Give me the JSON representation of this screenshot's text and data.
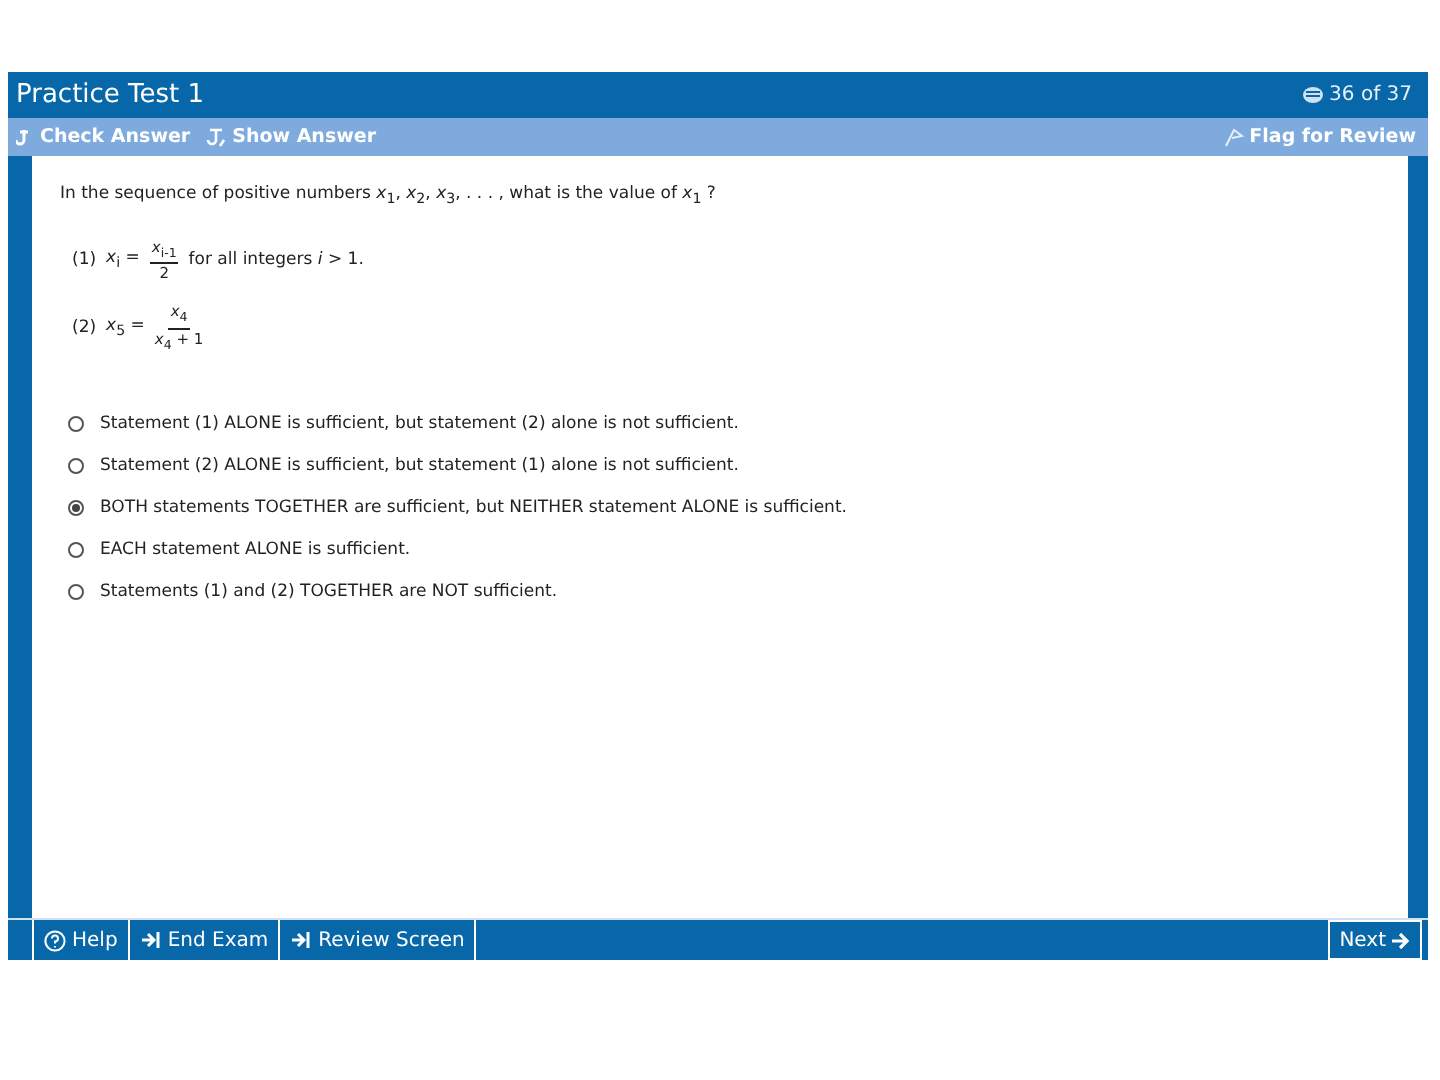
{
  "window": {
    "title": "Practice Test 1",
    "progress": "36 of 37"
  },
  "toolbar": {
    "left": [
      {
        "label": "Check Answer",
        "kind": "check"
      },
      {
        "label": "Show Answer",
        "kind": "show"
      }
    ],
    "flag": "Flag for Review"
  },
  "question": {
    "stem": "In the sequence of positive numbers *x*$_{1}$, *x*$_{2}$, *x*$_{3}$, . . . , what is the value of *x*$_{1}$ ?",
    "statements": [
      {
        "number": "(1)",
        "lhs": "*x*$_{i}$ =",
        "numerator": "*x*$_{i-1}$",
        "denominator": "2",
        "suffix": "for all integers *i* > 1."
      },
      {
        "number": "(2)",
        "lhs": "*x*$_{5}$ =",
        "numerator": "*x*$_{4}$",
        "denominator": "*x*$_{4}$ + 1"
      }
    ],
    "choices": [
      {
        "text": "Statement (1) ALONE is sufficient, but statement (2) alone is not sufficient.",
        "selected": false
      },
      {
        "text": "Statement (2) ALONE is sufficient, but statement (1) alone is not sufficient.",
        "selected": false
      },
      {
        "text": "BOTH statements TOGETHER are sufficient, but NEITHER statement ALONE is sufficient.",
        "selected": true
      },
      {
        "text": "EACH statement ALONE is sufficient.",
        "selected": false
      },
      {
        "text": "Statements (1) and (2) TOGETHER are NOT sufficient.",
        "selected": false
      }
    ]
  },
  "footer": {
    "buttons": [
      {
        "label": "Help",
        "kind": "help"
      },
      {
        "label": "End Exam",
        "kind": "end"
      },
      {
        "label": "Review Screen",
        "kind": "review"
      }
    ],
    "next": "Next"
  }
}
